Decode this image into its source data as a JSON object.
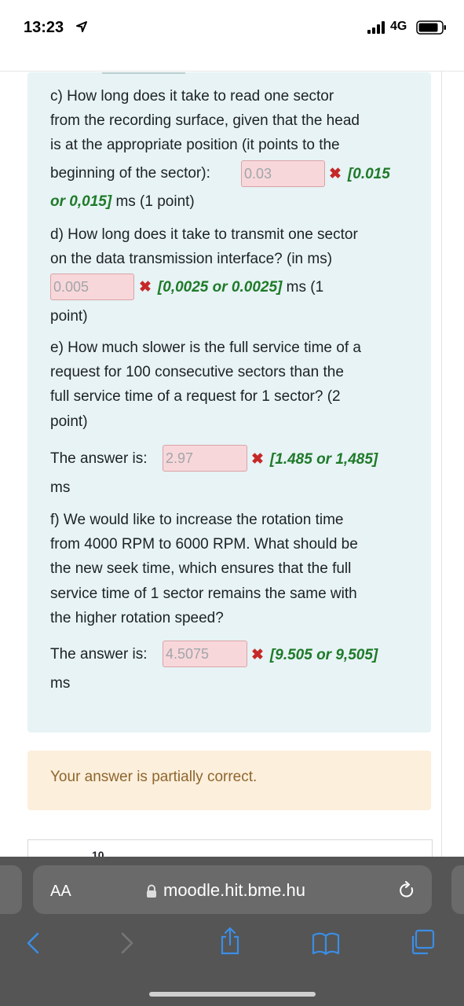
{
  "status_bar": {
    "time": "13:23",
    "network": "4G"
  },
  "question": {
    "c_lines": [
      "c) How long does it take to read one sector",
      "from the recording surface, given that the head",
      "is at the appropriate position (it points to the",
      "beginning of the sector):"
    ],
    "c_answer": "0.03",
    "c_feedback": "[0.015",
    "c_feedback2": "or 0,015]",
    "c_tail": "ms (1 point)",
    "d_lines": [
      "d) How long does it take to transmit one sector",
      "on the data transmission interface? (in ms)"
    ],
    "d_answer": "0.005",
    "d_feedback": "[0,0025 or 0.0025]",
    "d_tail": "ms (1",
    "d_tail2": "point)",
    "e_lines": [
      "e) How much slower is the full service time of a",
      "request for 100 consecutive sectors than the",
      "full service time of a request for 1 sector? (2",
      "point)"
    ],
    "e_label": "The answer is:",
    "e_answer": "2.97",
    "e_feedback": "[1.485 or 1,485]",
    "e_unit": "ms",
    "f_lines": [
      "f) We would like to increase the rotation time",
      "from 4000 RPM to 6000 RPM. What should be",
      "the new seek time, which ensures that the full",
      "service time of 1 sector remains the same with",
      "the higher rotation speed?"
    ],
    "f_label": "The answer is:",
    "f_answer": "4.5075",
    "f_feedback": "[9.505 or 9,505]",
    "f_unit": "ms",
    "incorrect_mark": "✖"
  },
  "outcome": "Your answer is partially correct.",
  "next_question_number": "10",
  "browser": {
    "text_size": "AA",
    "url": "moodle.hit.bme.hu"
  }
}
